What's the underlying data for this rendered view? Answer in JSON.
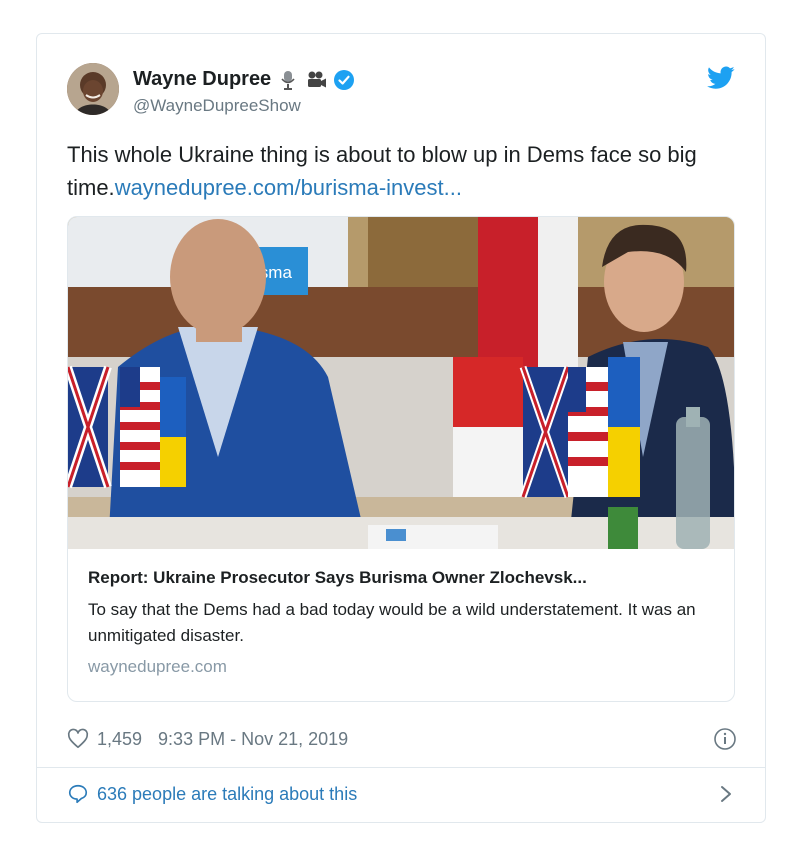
{
  "author": {
    "name": "Wayne Dupree",
    "handle": "@WayneDupreeShow",
    "name_emoji_icons": [
      "microphone-icon",
      "movie-camera-icon"
    ],
    "verified": true
  },
  "tweet": {
    "text": "This whole Ukraine thing is about to blow up in Dems face so big time.",
    "link_text": "waynedupree.com/burisma-invest..."
  },
  "card": {
    "title": "Report: Ukraine Prosecutor Says Burisma Owner Zlochevsk...",
    "description": "To say that the Dems had a bad today would be a wild understatement. It was an unmitigated disaster.",
    "domain": "waynedupree.com",
    "image_banner_text": "isma"
  },
  "meta": {
    "likes": "1,459",
    "timestamp": "9:33 PM - Nov 21, 2019"
  },
  "footer": {
    "talking_label": "636 people are talking about this"
  },
  "colors": {
    "link": "#2b7bb9",
    "twitter_blue": "#1da1f2",
    "muted": "#697882",
    "border": "#e1e8ed"
  }
}
